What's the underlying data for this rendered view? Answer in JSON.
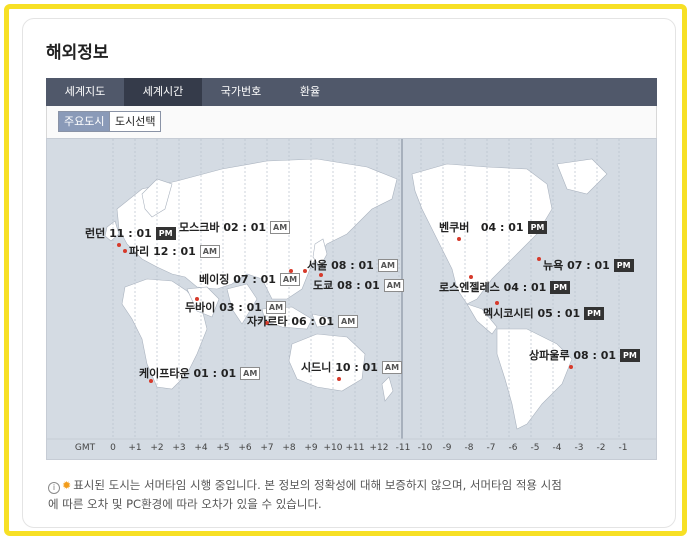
{
  "title": "해외정보",
  "tabs": [
    {
      "label": "세계지도",
      "active": false
    },
    {
      "label": "세계시간",
      "active": true
    },
    {
      "label": "국가번호",
      "active": false
    },
    {
      "label": "환율",
      "active": false
    }
  ],
  "subtabs": {
    "major": "주요도시",
    "select": "도시선택"
  },
  "cities": [
    {
      "name": "런던",
      "time": "11 : 01",
      "ampm": "PM"
    },
    {
      "name": "파리",
      "time": "12 : 01",
      "ampm": "AM"
    },
    {
      "name": "모스크바",
      "time": "02 : 01",
      "ampm": "AM"
    },
    {
      "name": "베이징",
      "time": "07 : 01",
      "ampm": "AM"
    },
    {
      "name": "서울",
      "time": "08 : 01",
      "ampm": "AM"
    },
    {
      "name": "도쿄",
      "time": "08 : 01",
      "ampm": "AM"
    },
    {
      "name": "두바이",
      "time": "03 : 01",
      "ampm": "AM"
    },
    {
      "name": "자카르타",
      "time": "06 : 01",
      "ampm": "AM"
    },
    {
      "name": "시드니",
      "time": "10 : 01",
      "ampm": "AM"
    },
    {
      "name": "케이프타운",
      "time": "01 : 01",
      "ampm": "AM"
    },
    {
      "name": "벤쿠버",
      "time": "04 : 01",
      "ampm": "PM"
    },
    {
      "name": "로스엔젤레스",
      "time": "04 : 01",
      "ampm": "PM"
    },
    {
      "name": "뉴욕",
      "time": "07 : 01",
      "ampm": "PM"
    },
    {
      "name": "멕시코시티",
      "time": "05 : 01",
      "ampm": "PM"
    },
    {
      "name": "상파울루",
      "time": "08 : 01",
      "ampm": "PM"
    }
  ],
  "gmt_label": "GMT",
  "gmt_offsets": [
    "0",
    "+1",
    "+2",
    "+3",
    "+4",
    "+5",
    "+6",
    "+7",
    "+8",
    "+9",
    "+10",
    "+11",
    "+12",
    "-11",
    "-10",
    "-9",
    "-8",
    "-7",
    "-6",
    "-5",
    "-4",
    "-3",
    "-2",
    "-1"
  ],
  "notice": {
    "line1": "표시된 도시는 서머타임 시행 중입니다. 본 정보의 정확성에 대해 보증하지 않으며, 서머타임 적용 시점",
    "line2": "에 따른 오차 및 PC환경에 따라 오차가 있을 수 있습니다."
  },
  "colors": {
    "tabbar": "#50586a",
    "tab_active": "#353b4a",
    "ocean": "#d4dbe3",
    "land": "#ffffff",
    "highlight": "#f7e025",
    "city_dot": "#d63a2b"
  }
}
